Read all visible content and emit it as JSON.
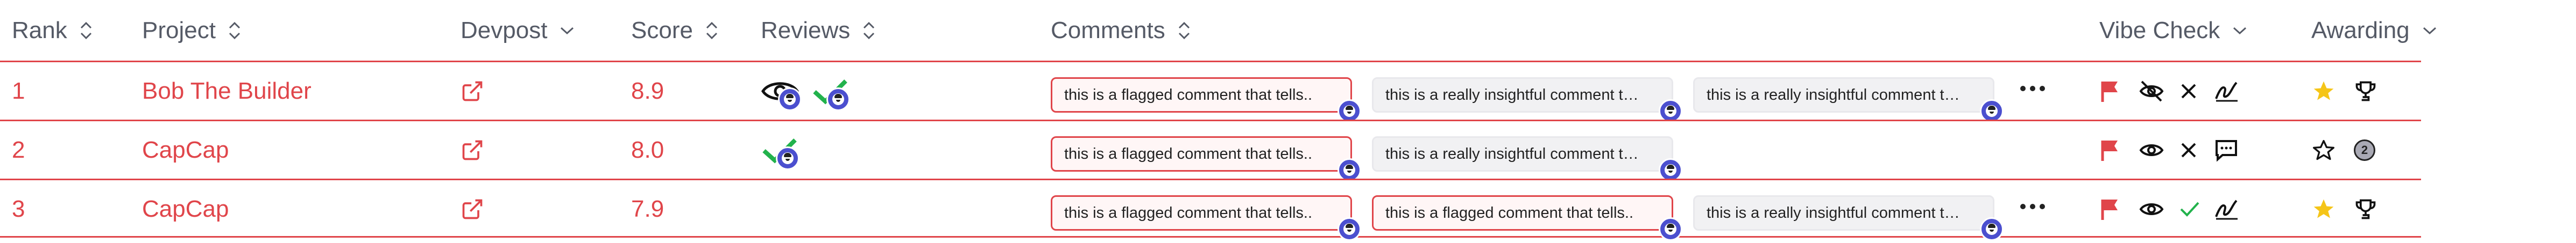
{
  "headers": {
    "rank": "Rank",
    "project": "Project",
    "devpost": "Devpost",
    "score": "Score",
    "reviews": "Reviews",
    "comments": "Comments",
    "vibe_check": "Vibe Check",
    "awarding": "Awarding"
  },
  "rows": [
    {
      "rank": "1",
      "project": "Bob The Builder",
      "score": "8.9",
      "reviews": [
        "eye-avatar-icon",
        "check-avatar-icon"
      ],
      "comments": [
        {
          "text": "this is a flagged comment that tells..",
          "flagged": true
        },
        {
          "text": "this is a really insightful comment that..",
          "flagged": false
        },
        {
          "text": "this is a really insightful comment that..",
          "flagged": false
        }
      ],
      "has_more": true,
      "vibe": [
        "flag-icon",
        "eye-off-icon",
        "x-icon",
        "signature-icon"
      ],
      "awarding": [
        "star-filled-icon",
        "trophy-icon"
      ]
    },
    {
      "rank": "2",
      "project": "CapCap",
      "score": "8.0",
      "reviews": [
        "check-avatar-icon"
      ],
      "comments": [
        {
          "text": "this is a flagged comment that tells..",
          "flagged": true
        },
        {
          "text": "this is a really insightful comment that..",
          "flagged": false
        }
      ],
      "has_more": false,
      "vibe": [
        "flag-icon",
        "eye-icon",
        "x-icon",
        "message-icon"
      ],
      "awarding": [
        "star-outline-icon",
        "badge-2-icon"
      ],
      "award_badge_label": "2"
    },
    {
      "rank": "3",
      "project": "CapCap",
      "score": "7.9",
      "reviews": [],
      "comments": [
        {
          "text": "this is a flagged comment that tells..",
          "flagged": true
        },
        {
          "text": "this is a flagged comment that tells..",
          "flagged": true
        },
        {
          "text": "this is a really insightful comment that..",
          "flagged": false
        }
      ],
      "has_more": true,
      "vibe": [
        "flag-icon",
        "eye-icon",
        "check-icon",
        "signature-icon"
      ],
      "awarding": [
        "star-filled-icon",
        "trophy-icon"
      ]
    }
  ],
  "colors": {
    "accent_red": "#e0454a",
    "check_green": "#22b24c",
    "star_yellow": "#f5c518",
    "avatar_indigo": "#4b4fcf",
    "header_text": "#555a66"
  }
}
